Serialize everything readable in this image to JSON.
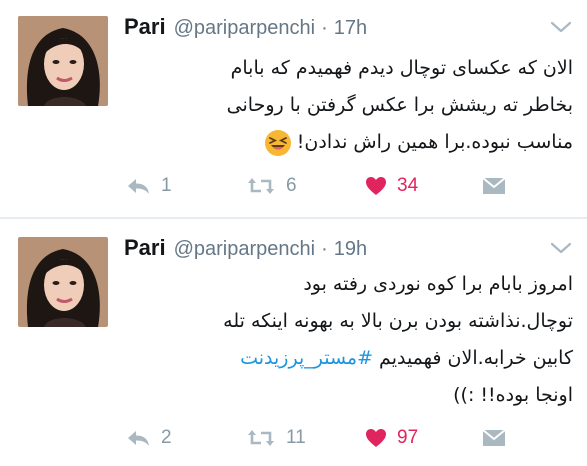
{
  "tweets": [
    {
      "name": "Pari",
      "handle": "@pariparpenchi",
      "separator": "·",
      "time": "17h",
      "lines": [
        "الان که عکسای توچال دیدم فهمیدم که بابام",
        "بخاطر ته ریشش برا عکس گرفتن با روحانی",
        "مناسب نبوده.برا همین راش ندادن!"
      ],
      "emoji": "grinning-squinting-face-icon",
      "replies": "1",
      "retweets": "6",
      "likes": "34"
    },
    {
      "name": "Pari",
      "handle": "@pariparpenchi",
      "separator": "·",
      "time": "19h",
      "lines": [
        "امروز بابام  برا کوه نوردی رفته بود",
        "توچال.نذاشته بودن برن بالا به بهونه اینکه تله",
        "کابین خرابه.الان فهمیدیم"
      ],
      "hashtag": "#مستر_پرزیدنت",
      "last_line": "اونجا بوده!! :))",
      "replies": "2",
      "retweets": "11",
      "likes": "97"
    }
  ],
  "colors": {
    "like_active": "#e0245e",
    "action_gray": "#8899a6",
    "hashtag_blue": "#1b95e0",
    "divider": "#e6ecf0"
  }
}
